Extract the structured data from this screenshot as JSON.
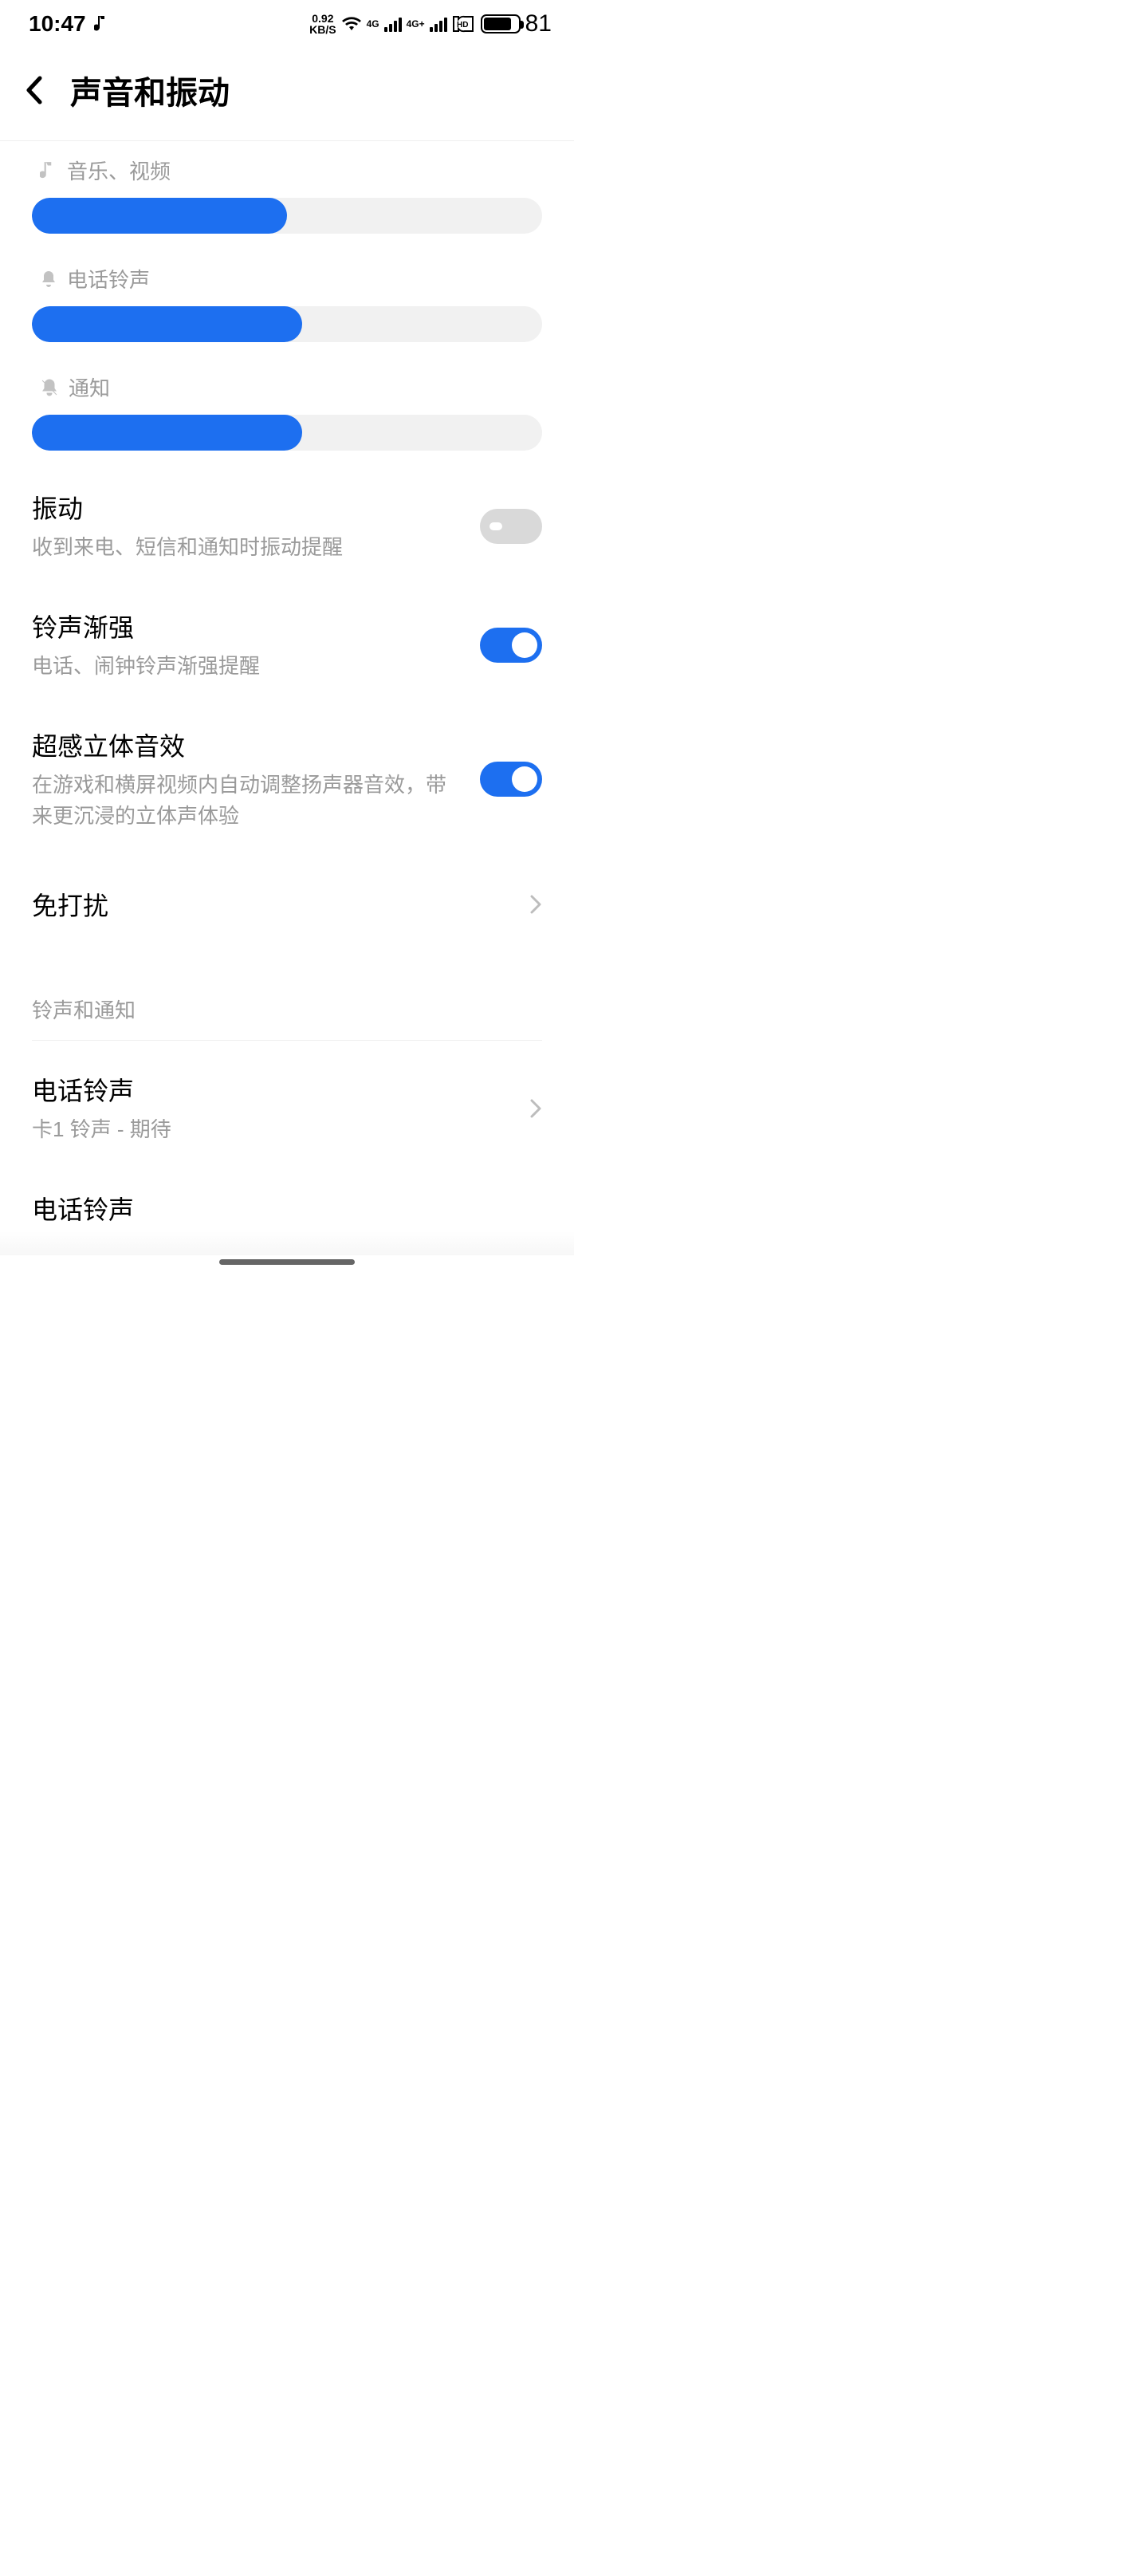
{
  "status": {
    "time": "10:47",
    "net_speed_top": "0.92",
    "net_speed_unit": "KB/S",
    "sig1_label": "4G",
    "sig2_label": "4G+",
    "hd_label": "HD",
    "hd_sub": "1 2",
    "battery": "81"
  },
  "header": {
    "title": "声音和振动"
  },
  "sliders": {
    "media": {
      "label": "音乐、视频",
      "percent": 50
    },
    "ringtone": {
      "label": "电话铃声",
      "percent": 53
    },
    "notification": {
      "label": "通知",
      "percent": 53
    }
  },
  "toggles": {
    "vibrate": {
      "title": "振动",
      "subtitle": "收到来电、短信和通知时振动提醒",
      "on": false
    },
    "ascend": {
      "title": "铃声渐强",
      "subtitle": "电话、闹钟铃声渐强提醒",
      "on": true
    },
    "stereo": {
      "title": "超感立体音效",
      "subtitle": "在游戏和横屏视频内自动调整扬声器音效，带来更沉浸的立体声体验",
      "on": true
    }
  },
  "links": {
    "dnd": {
      "title": "免打扰"
    }
  },
  "group": {
    "title": "铃声和通知"
  },
  "ringtones": {
    "sim1": {
      "title": "电话铃声",
      "subtitle": "卡1 铃声 - 期待"
    },
    "sim2": {
      "title": "电话铃声"
    }
  }
}
